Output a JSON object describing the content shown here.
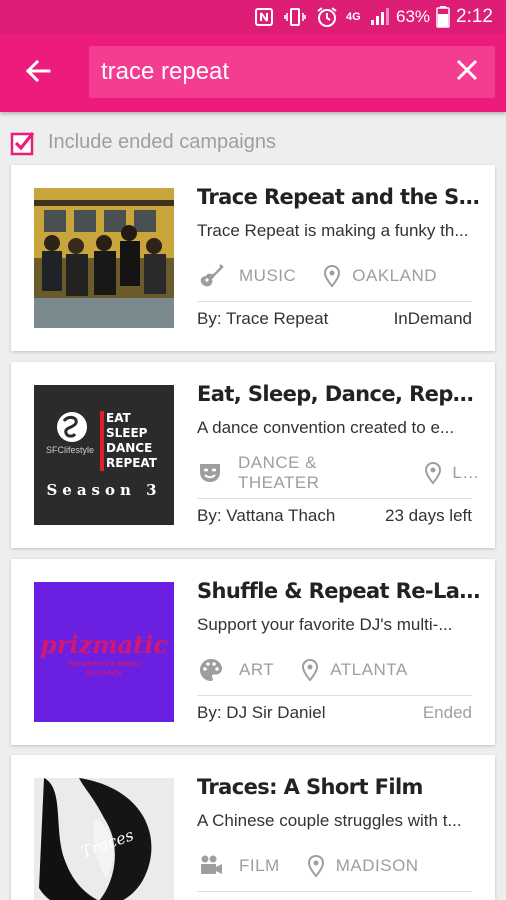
{
  "status_bar": {
    "network": "4G",
    "battery_percent": "63%",
    "time": "2:12",
    "icons": [
      "nfc-icon",
      "vibrate-icon",
      "alarm-icon",
      "signal-icon",
      "battery-icon"
    ]
  },
  "app_bar": {
    "back_icon": "arrow-back-icon",
    "search_value": "trace repeat",
    "clear_icon": "close-icon",
    "colors": {
      "status_bar": "#de1d76",
      "app_bar": "#ec1b7c",
      "search_box": "#f43d91"
    }
  },
  "filter": {
    "label": "Include ended campaigns",
    "checked": true,
    "color": "#ec1b7c"
  },
  "campaigns": [
    {
      "title": "Trace Repeat and the Sou...",
      "description": "Trace Repeat is making a funky th...",
      "category": "MUSIC",
      "category_icon": "guitar-icon",
      "location": "OAKLAND",
      "by_prefix": "By: ",
      "creator": "Trace Repeat",
      "status": "InDemand",
      "ended": false
    },
    {
      "title": "Eat, Sleep, Dance, Repeat...",
      "description": "A dance convention created to e...",
      "category": "DANCE & THEATER",
      "category_icon": "theater-mask-icon",
      "location": "L...",
      "by_prefix": "By: ",
      "creator": "Vattana Thach",
      "status": "23 days left",
      "ended": false,
      "thumb_text": {
        "brand": "SFClifestyle",
        "line1": "EAT",
        "line2": "SLEEP",
        "line3": "DANCE",
        "line4": "REPEAT",
        "season": "Season 3"
      }
    },
    {
      "title": "Shuffle & Repeat Re-Laun...",
      "description": "Support your favorite DJ's multi-...",
      "category": "ART",
      "category_icon": "palette-icon",
      "location": "ATLANTA",
      "by_prefix": "By: ",
      "creator": "DJ Sir Daniel",
      "status": "Ended",
      "ended": true,
      "thumb_text": {
        "logo": "prizmatic",
        "line1": "THE SHUFFLE & REPEAT",
        "line2": "RE-LAUNCH"
      }
    },
    {
      "title": "Traces: A Short Film",
      "description": "A Chinese couple struggles with t...",
      "category": "FILM",
      "category_icon": "video-camera-icon",
      "location": "MADISON",
      "thumb_text": {
        "handwritten": "Traces"
      }
    }
  ],
  "location_icon": "map-pin-icon"
}
